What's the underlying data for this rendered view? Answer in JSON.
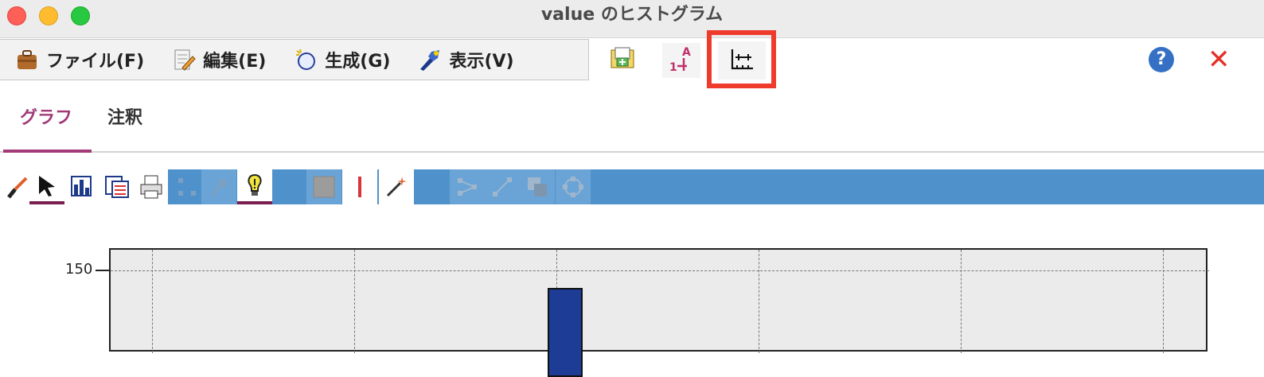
{
  "window": {
    "title": "value のヒストグラム"
  },
  "menubar": {
    "items": [
      {
        "label": "ファイル(F)",
        "icon": "briefcase-icon"
      },
      {
        "label": "編集(E)",
        "icon": "edit-pencil-icon"
      },
      {
        "label": "生成(G)",
        "icon": "magic-wand-icon"
      },
      {
        "label": "表示(V)",
        "icon": "flashlight-icon"
      }
    ]
  },
  "toolbar": {
    "buttons": [
      {
        "icon": "add-graph-icon"
      },
      {
        "icon": "axis-label-icon"
      },
      {
        "icon": "axis-ticks-icon",
        "highlighted": true
      }
    ],
    "help_label": "?",
    "close_label": "✕"
  },
  "tabs": [
    {
      "label": "グラフ",
      "active": true
    },
    {
      "label": "注釈",
      "active": false
    }
  ],
  "graph_toolbar": {
    "buttons": [
      "paintbrush-icon",
      "pointer-icon",
      "bar-chart-icon",
      "table-icon",
      "printer-icon",
      "grid-select-icon",
      "pin-icon",
      "lightbulb-icon",
      "fill-square-icon",
      "line-color-icon",
      "magic-wand-icon",
      "connect-nodes-icon",
      "line-segment-icon",
      "overlap-icon",
      "circle-nodes-icon"
    ]
  },
  "colors": {
    "accent": "#a23a78",
    "toolbar_blue": "#4f92cb",
    "highlight": "#ee3b2b",
    "bar": "#1c3c95"
  },
  "chart_data": {
    "type": "bar",
    "ytick_labels": [
      "150"
    ],
    "ylim_visible_top": 160,
    "bars": [
      {
        "value": 136
      }
    ],
    "grid": true
  }
}
